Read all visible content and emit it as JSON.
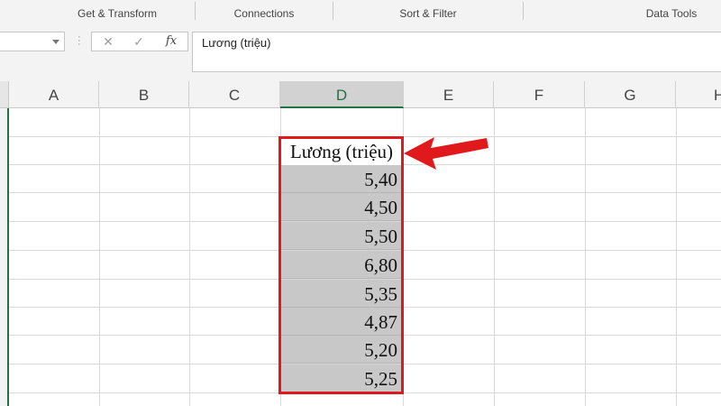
{
  "ribbon": {
    "groups": [
      "Get & Transform",
      "Connections",
      "Sort & Filter",
      "Data Tools"
    ]
  },
  "formula_bar": {
    "name_box_value": "",
    "cancel_icon": "close-icon",
    "enter_icon": "check-icon",
    "fx_label": "fx",
    "content": "Lương (triệu)"
  },
  "columns": [
    "A",
    "B",
    "C",
    "D",
    "E",
    "F",
    "G",
    "H"
  ],
  "selected_column": "D",
  "column_d": {
    "header": "Lương (triệu)",
    "values": [
      "5,40",
      "4,50",
      "5,50",
      "6,80",
      "5,35",
      "4,87",
      "5,20",
      "5,25"
    ]
  },
  "colors": {
    "accent": "#217346",
    "highlight_border": "#e0191c",
    "selection_fill": "#c8c8c8"
  }
}
